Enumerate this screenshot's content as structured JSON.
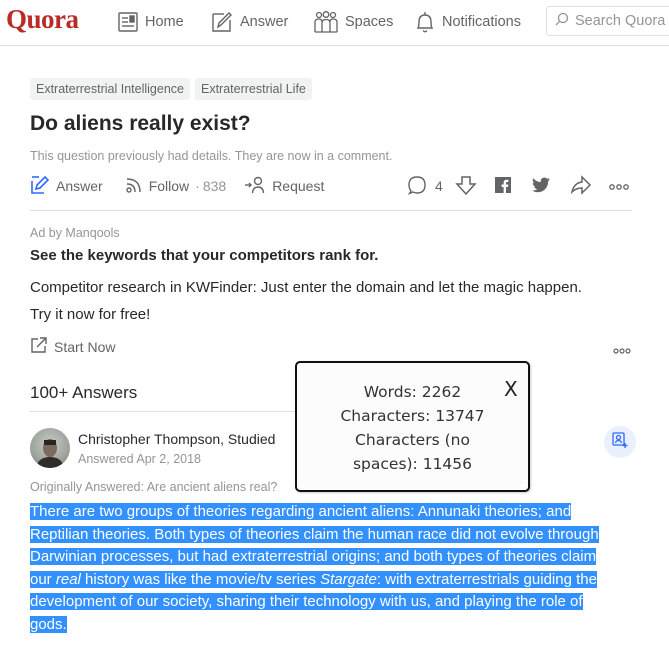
{
  "header": {
    "logo": "Quora",
    "nav": [
      {
        "label": "Home",
        "icon": "home-feed-icon"
      },
      {
        "label": "Answer",
        "icon": "pencil-square-icon"
      },
      {
        "label": "Spaces",
        "icon": "group-people-icon"
      },
      {
        "label": "Notifications",
        "icon": "bell-icon"
      }
    ],
    "search_placeholder": "Search Quora",
    "brand_color": "#b92b27"
  },
  "question": {
    "tags": [
      "Extraterrestrial Intelligence",
      "Extraterrestrial Life"
    ],
    "title": "Do aliens really exist?",
    "note": "This question previously had details. They are now in a comment.",
    "actions": {
      "answer_label": "Answer",
      "follow_label": "Follow",
      "follow_count": "838",
      "request_label": "Request",
      "comment_count": "4"
    }
  },
  "ad": {
    "by": "Ad by Manqools",
    "title": "See the keywords that your competitors rank for.",
    "body_line1": "Competitor research in KWFinder: Just enter the domain and let the magic happen.",
    "body_line2": "Try it now for free!",
    "cta": "Start Now"
  },
  "answers": {
    "heading": "100+ Answers",
    "first": {
      "author": "Christopher Thompson, Studied",
      "answered": "Answered Apr 2, 2018",
      "originally": "Originally Answered: Are ancient aliens real?",
      "body": {
        "p1": "There are two groups of theories regarding ancient aliens: Annunaki theories; and Reptilian theories. Both types of theories claim the human race did not evolve through Darwinian processes, but had extraterrestrial origins; and both types of theories claim our ",
        "em1": "real",
        "p2": " history was like the movie/tv series ",
        "em2": "Stargate",
        "p3": ": with extraterrestrials guiding the development of our society, sharing their technology with us, and playing the role of gods."
      },
      "selection_color": "#3390ff"
    }
  },
  "word_count_popup": {
    "words": "Words: 2262",
    "characters": "Characters: 13747",
    "characters_no_spaces_1": "Characters (no",
    "characters_no_spaces_2": "spaces): 11456",
    "close": "X"
  }
}
